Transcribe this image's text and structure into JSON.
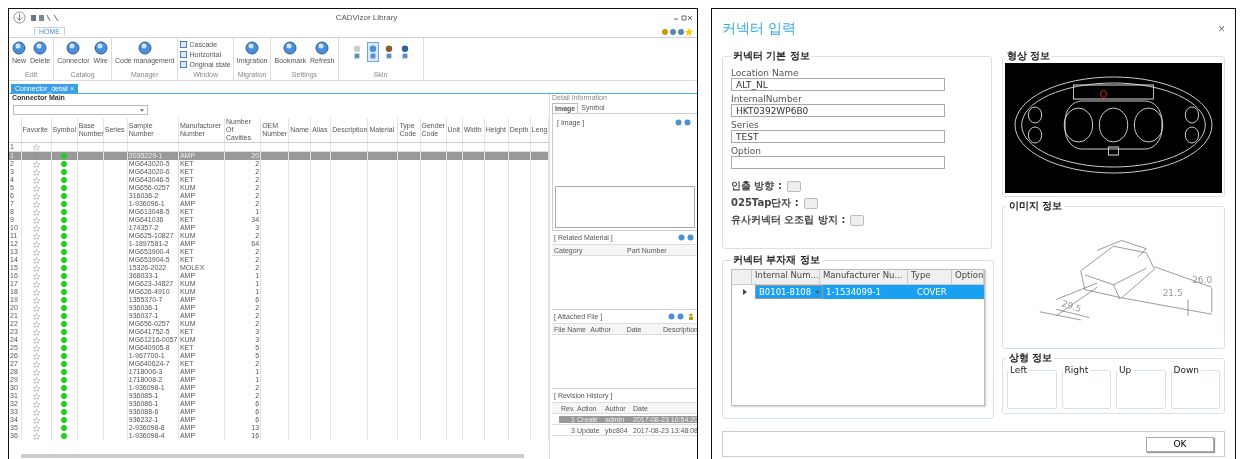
{
  "library": {
    "title": "CADVizor Library",
    "ribbon_tab": {
      "label": "HOME",
      "selected": true
    },
    "groups": [
      {
        "label": "Edit",
        "items": [
          {
            "kind": "large",
            "label": "New"
          },
          {
            "kind": "large",
            "label": "Delete"
          }
        ]
      },
      {
        "label": "Catalog",
        "items": [
          {
            "kind": "large",
            "label": "Connector"
          },
          {
            "kind": "large",
            "label": "Wire"
          }
        ]
      },
      {
        "label": "Manager",
        "items": [
          {
            "kind": "large",
            "label": "Code management"
          }
        ]
      },
      {
        "label": "Window",
        "items": [
          {
            "kind": "small",
            "label": "Cascade"
          },
          {
            "kind": "small",
            "label": "Horizontal"
          },
          {
            "kind": "small",
            "label": "Original state"
          }
        ]
      },
      {
        "label": "Migration",
        "items": [
          {
            "kind": "large",
            "label": "Imigration"
          }
        ]
      },
      {
        "label": "Settings",
        "items": [
          {
            "kind": "large",
            "label": "Bookmark"
          },
          {
            "kind": "large",
            "label": "Refresh"
          }
        ]
      },
      {
        "label": "Skin",
        "items": [
          {
            "kind": "swatch",
            "selected": false
          },
          {
            "kind": "swatch",
            "selected": true
          },
          {
            "kind": "swatch",
            "selected": false
          },
          {
            "kind": "swatch",
            "selected": false
          }
        ]
      }
    ],
    "doc_tab": {
      "label": "Connector_detail",
      "close": "×"
    },
    "main": {
      "title": "Connector Main",
      "columns": [
        "Favorite",
        "Symbol",
        "Base Number",
        "Series",
        "Sample Number",
        "Manufacturer Number",
        "Number Of Cavities",
        "OEM Number",
        "Name",
        "Alias",
        "Description",
        "Material",
        "Type Code",
        "Gender Code",
        "Unit",
        "Width",
        "Height",
        "Depth",
        "Leng"
      ],
      "filter_row": "1",
      "rows": [
        {
          "n": "1",
          "favorite": false,
          "sample": "2035229-1",
          "maker": "AMP",
          "cavities": "20",
          "selected": true
        },
        {
          "n": "2",
          "favorite": false,
          "sample": "MG643020-5",
          "maker": "KET",
          "cavities": "2",
          "selected": false
        },
        {
          "n": "3",
          "favorite": false,
          "sample": "MG643020-6",
          "maker": "KET",
          "cavities": "2",
          "selected": false
        },
        {
          "n": "4",
          "favorite": false,
          "sample": "MG643046-5",
          "maker": "KET",
          "cavities": "2",
          "selected": false
        },
        {
          "n": "5",
          "favorite": false,
          "sample": "MG656-0257",
          "maker": "KUM",
          "cavities": "2",
          "selected": false
        },
        {
          "n": "6",
          "favorite": false,
          "sample": "316036-2",
          "maker": "AMP",
          "cavities": "2",
          "selected": false
        },
        {
          "n": "7",
          "favorite": false,
          "sample": "1-936096-1",
          "maker": "AMP",
          "cavities": "2",
          "selected": false
        },
        {
          "n": "8",
          "favorite": false,
          "sample": "MG613048-5",
          "maker": "KET",
          "cavities": "1",
          "selected": false
        },
        {
          "n": "9",
          "favorite": false,
          "sample": "MG641036",
          "maker": "KET",
          "cavities": "34",
          "selected": false
        },
        {
          "n": "10",
          "favorite": false,
          "sample": "174357-2",
          "maker": "AMP",
          "cavities": "3",
          "selected": false
        },
        {
          "n": "11",
          "favorite": false,
          "sample": "MG625-10827",
          "maker": "KUM",
          "cavities": "2",
          "selected": false
        },
        {
          "n": "12",
          "favorite": false,
          "sample": "1-1897581-2",
          "maker": "AMP",
          "cavities": "64",
          "selected": false
        },
        {
          "n": "13",
          "favorite": false,
          "sample": "MG653900-4",
          "maker": "KET",
          "cavities": "2",
          "selected": false
        },
        {
          "n": "14",
          "favorite": false,
          "sample": "MG653904-5",
          "maker": "KET",
          "cavities": "2",
          "selected": false
        },
        {
          "n": "15",
          "favorite": false,
          "sample": "15326-2022",
          "maker": "MOLEX",
          "cavities": "2",
          "selected": false
        },
        {
          "n": "16",
          "favorite": false,
          "sample": "368033-1",
          "maker": "AMP",
          "cavities": "1",
          "selected": false
        },
        {
          "n": "17",
          "favorite": false,
          "sample": "MG623-J4827",
          "maker": "KUM",
          "cavities": "1",
          "selected": false
        },
        {
          "n": "18",
          "favorite": false,
          "sample": "MG626-4910",
          "maker": "KUM",
          "cavities": "1",
          "selected": false
        },
        {
          "n": "19",
          "favorite": false,
          "sample": "1355370-7",
          "maker": "AMP",
          "cavities": "6",
          "selected": false
        },
        {
          "n": "20",
          "favorite": false,
          "sample": "936036-1",
          "maker": "AMP",
          "cavities": "2",
          "selected": false
        },
        {
          "n": "21",
          "favorite": false,
          "sample": "936037-1",
          "maker": "AMP",
          "cavities": "2",
          "selected": false
        },
        {
          "n": "22",
          "favorite": false,
          "sample": "MG656-0257",
          "maker": "KUM",
          "cavities": "2",
          "selected": false
        },
        {
          "n": "23",
          "favorite": false,
          "sample": "MG641752-5",
          "maker": "KET",
          "cavities": "3",
          "selected": false
        },
        {
          "n": "24",
          "favorite": false,
          "sample": "MG61216-0057",
          "maker": "KUM",
          "cavities": "3",
          "selected": false
        },
        {
          "n": "25",
          "favorite": false,
          "sample": "MG640905-8",
          "maker": "KET",
          "cavities": "5",
          "selected": false
        },
        {
          "n": "26",
          "favorite": false,
          "sample": "1-967700-1",
          "maker": "AMP",
          "cavities": "5",
          "selected": false
        },
        {
          "n": "27",
          "favorite": false,
          "sample": "MG640624-7",
          "maker": "KET",
          "cavities": "2",
          "selected": false
        },
        {
          "n": "28",
          "favorite": false,
          "sample": "1718006-3",
          "maker": "AMP",
          "cavities": "1",
          "selected": false
        },
        {
          "n": "29",
          "favorite": false,
          "sample": "1718008-2",
          "maker": "AMP",
          "cavities": "1",
          "selected": false
        },
        {
          "n": "30",
          "favorite": false,
          "sample": "1-936098-1",
          "maker": "AMP",
          "cavities": "2",
          "selected": false
        },
        {
          "n": "31",
          "favorite": false,
          "sample": "936085-1",
          "maker": "AMP",
          "cavities": "2",
          "selected": false
        },
        {
          "n": "32",
          "favorite": false,
          "sample": "936086-1",
          "maker": "AMP",
          "cavities": "6",
          "selected": false
        },
        {
          "n": "33",
          "favorite": false,
          "sample": "936088-6",
          "maker": "AMP",
          "cavities": "6",
          "selected": false
        },
        {
          "n": "34",
          "favorite": false,
          "sample": "936232-1",
          "maker": "AMP",
          "cavities": "6",
          "selected": false
        },
        {
          "n": "35",
          "favorite": false,
          "sample": "2-936098-8",
          "maker": "AMP",
          "cavities": "13",
          "selected": false
        },
        {
          "n": "36",
          "favorite": false,
          "sample": "1-936098-4",
          "maker": "AMP",
          "cavities": "16",
          "selected": false
        }
      ]
    },
    "detail": {
      "title": "Detail Information",
      "tabs": [
        {
          "label": "Image",
          "selected": true
        },
        {
          "label": "Symbol",
          "selected": false
        }
      ],
      "image_section": "[ Image ]",
      "related": {
        "title": "[ Related Material ]",
        "columns": [
          "Category",
          "Part Number"
        ]
      },
      "attached": {
        "title": "[ Attached File ]",
        "columns": [
          "File Name",
          "Author",
          "Date",
          "Description"
        ]
      },
      "history": {
        "title": "[ Revision History ]",
        "columns": [
          "Rev.",
          "Action",
          "Author",
          "Date"
        ],
        "rows": [
          {
            "rev": "1",
            "action": "Create",
            "author": "admin",
            "date": "2017-08-23 10:54:20",
            "selected": true
          },
          {
            "rev": "3",
            "action": "Update",
            "author": "ybc804",
            "date": "2017-08-23 13:48:08",
            "selected": false
          }
        ]
      }
    }
  },
  "dialog": {
    "title": "커넥터 입력",
    "close": "×",
    "basic": {
      "title": "커넥터 기본 정보",
      "fields": [
        {
          "label": "Location Name",
          "value": "ALT_NL"
        },
        {
          "label": "InternalNumber",
          "value": "HKT0392WP6B0"
        },
        {
          "label": "Series",
          "value": "TEST"
        },
        {
          "label": "Option"
        }
      ],
      "checks": [
        {
          "label": "인출 방향 :",
          "checked": false
        },
        {
          "label": "025Tap단자 :",
          "checked": false
        },
        {
          "label": "유사커넥터 오조립 방지 :",
          "checked": false
        }
      ]
    },
    "parts": {
      "title": "커넥터 부자재 정보",
      "columns": [
        "Internal Num...",
        "Manufacturer Nu...",
        "Type",
        "Option"
      ],
      "rows": [
        {
          "internal": "B0101-8108",
          "manufacturer": "1-1534099-1",
          "type": "COVER",
          "selected": true
        }
      ]
    },
    "shape": {
      "title": "형상 정보"
    },
    "image": {
      "title": "이미지 정보",
      "dims": [
        "29.5",
        "21.5",
        "26.0"
      ]
    },
    "insert": {
      "title": "상형 정보",
      "boxes": [
        "Left",
        "Right",
        "Up",
        "Down"
      ]
    },
    "ok": "OK"
  }
}
